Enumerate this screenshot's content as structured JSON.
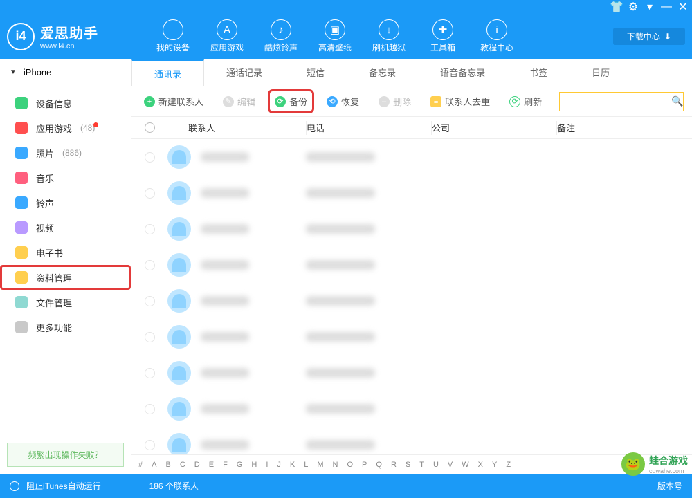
{
  "app": {
    "title": "爱思助手",
    "subtitle": "www.i4.cn",
    "download_center": "下载中心"
  },
  "top_nav": [
    {
      "label": "我的设备"
    },
    {
      "label": "应用游戏"
    },
    {
      "label": "酷炫铃声"
    },
    {
      "label": "高清壁纸"
    },
    {
      "label": "刷机越狱"
    },
    {
      "label": "工具箱"
    },
    {
      "label": "教程中心"
    }
  ],
  "device": {
    "name": "iPhone"
  },
  "sidebar": {
    "items": [
      {
        "label": "设备信息",
        "icon_bg": "#3cd27d",
        "count": ""
      },
      {
        "label": "应用游戏",
        "icon_bg": "#ff4f4f",
        "count": "(48)",
        "dot": true
      },
      {
        "label": "照片",
        "icon_bg": "#3aa9ff",
        "count": "(886)"
      },
      {
        "label": "音乐",
        "icon_bg": "#ff5f7e",
        "count": ""
      },
      {
        "label": "铃声",
        "icon_bg": "#3aa9ff",
        "count": ""
      },
      {
        "label": "视频",
        "icon_bg": "#b99aff",
        "count": ""
      },
      {
        "label": "电子书",
        "icon_bg": "#ffcf4f",
        "count": ""
      },
      {
        "label": "资料管理",
        "icon_bg": "#ffcf4f",
        "count": "",
        "highlight": true
      },
      {
        "label": "文件管理",
        "icon_bg": "#8fd9d2",
        "count": ""
      },
      {
        "label": "更多功能",
        "icon_bg": "#c9c9c9",
        "count": ""
      }
    ],
    "help": "频繁出现操作失败？"
  },
  "tabs": [
    {
      "label": "通讯录",
      "active": true
    },
    {
      "label": "通话记录"
    },
    {
      "label": "短信"
    },
    {
      "label": "备忘录"
    },
    {
      "label": "语音备忘录"
    },
    {
      "label": "书签"
    },
    {
      "label": "日历"
    }
  ],
  "toolbar": {
    "new": "新建联系人",
    "edit": "编辑",
    "backup": "备份",
    "restore": "恢复",
    "delete": "删除",
    "dedupe": "联系人去重",
    "refresh": "刷新",
    "search_placeholder": ""
  },
  "columns": {
    "contact": "联系人",
    "phone": "电话",
    "company": "公司",
    "note": "备注"
  },
  "alpha": [
    "#",
    "A",
    "B",
    "C",
    "D",
    "E",
    "F",
    "G",
    "H",
    "I",
    "J",
    "K",
    "L",
    "M",
    "N",
    "O",
    "P",
    "Q",
    "R",
    "S",
    "T",
    "U",
    "V",
    "W",
    "X",
    "Y",
    "Z"
  ],
  "status": {
    "block": "阻止iTunes自动运行",
    "count": "186 个联系人",
    "version": "版本号"
  },
  "watermark": {
    "name": "蛙合游戏",
    "url": "cdwahe.com"
  },
  "icon_colors": {
    "new": "#3cd27d",
    "edit": "#bbbbbb",
    "backup": "#3cd27d",
    "restore": "#3aa9ff",
    "delete": "#bbbbbb",
    "dedupe": "#ffcf4f",
    "refresh": "#3cd27d"
  },
  "row_count": 9
}
